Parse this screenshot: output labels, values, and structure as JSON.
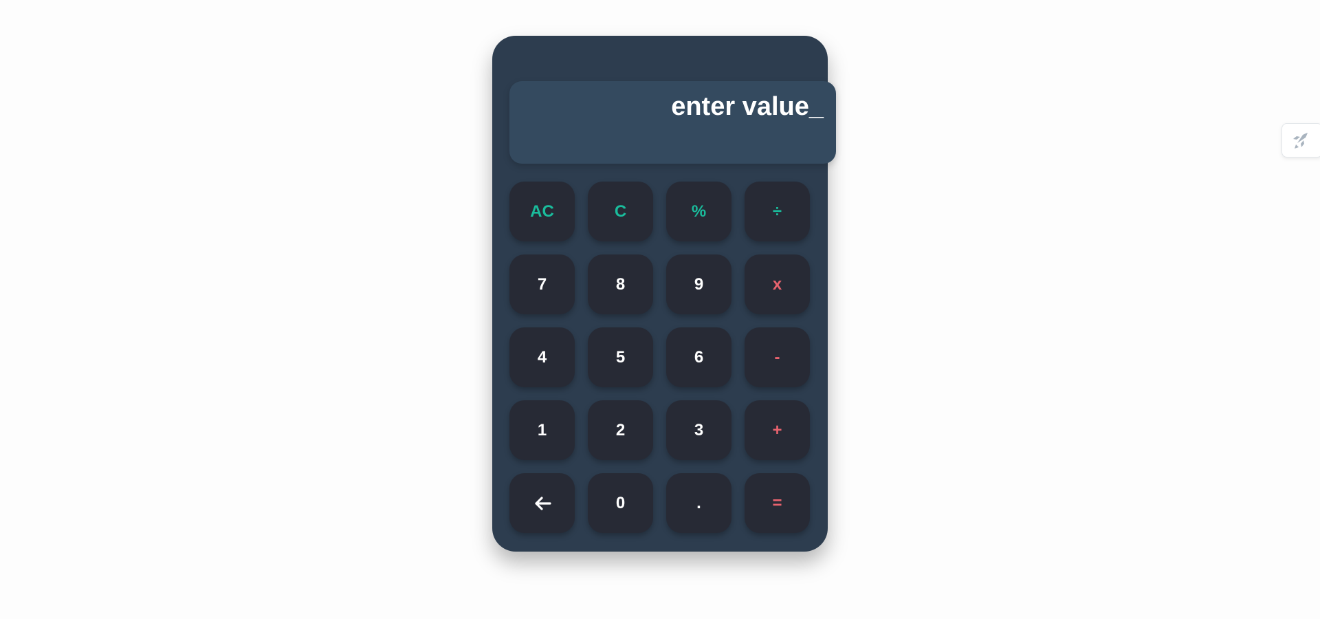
{
  "display": {
    "text": "enter value_"
  },
  "keys": {
    "ac": "AC",
    "clear": "C",
    "percent": "%",
    "divide": "÷",
    "seven": "7",
    "eight": "8",
    "nine": "9",
    "multiply": "x",
    "four": "4",
    "five": "5",
    "six": "6",
    "minus": "-",
    "one": "1",
    "two": "2",
    "three": "3",
    "plus": "+",
    "zero": "0",
    "dot": ".",
    "equals": "="
  },
  "icons": {
    "backspace": "arrow-left-icon",
    "side_badge": "rocket-icon"
  },
  "colors": {
    "body_bg": "#2d3d4f",
    "display_bg": "#344a5f",
    "key_bg": "#272a35",
    "function_key": "#1abc9c",
    "operator_key": "#e8636e",
    "number_key": "#ffffff"
  }
}
